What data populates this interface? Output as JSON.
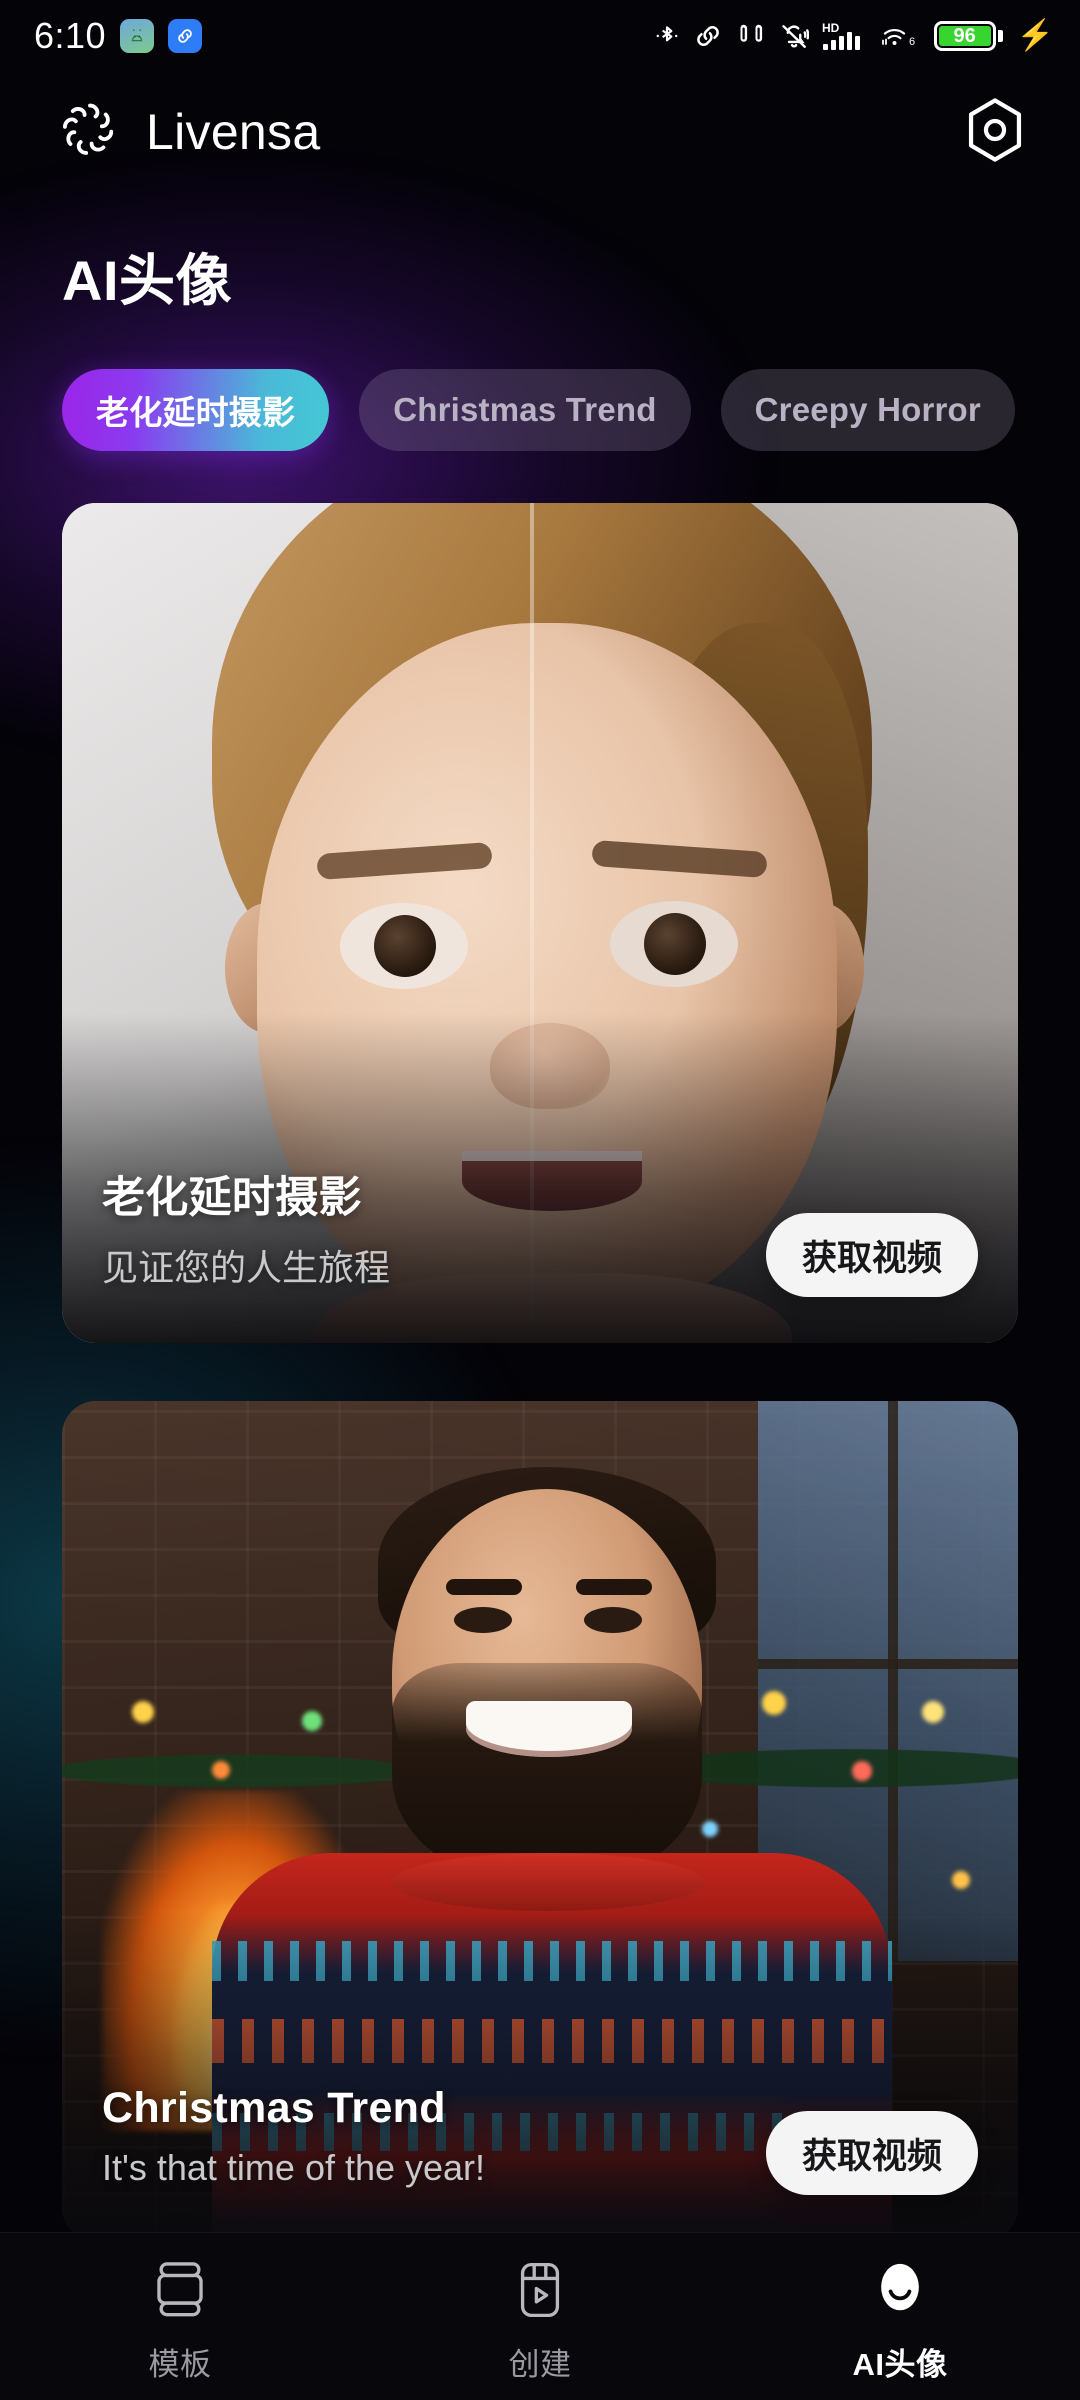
{
  "status_bar": {
    "time": "6:10",
    "left_icons": [
      "android-app-icon",
      "link-app-icon"
    ],
    "right_icons": [
      "bluetooth-icon",
      "link-icon",
      "earbuds-icon",
      "mute-bell-icon",
      "hd-signal-icon",
      "wifi-6-icon"
    ],
    "battery_percent": "96",
    "battery_color": "#38d430",
    "charging": "charging-bolt-icon"
  },
  "header": {
    "brand": "Livensa",
    "logo_icon": "livensa-knot-logo",
    "settings_icon": "hex-settings-icon"
  },
  "page": {
    "title": "AI头像"
  },
  "chips": [
    {
      "label": "老化延时摄影",
      "active": true
    },
    {
      "label": "Christmas Trend",
      "active": false
    },
    {
      "label": "Creepy Horror",
      "active": false
    }
  ],
  "cards": [
    {
      "title": "老化延时摄影",
      "subtitle": "见证您的人生旅程",
      "cta": "获取视频",
      "art": "toddler-aging-portrait"
    },
    {
      "title": "Christmas Trend",
      "subtitle": "It's that time of the year!",
      "cta": "获取视频",
      "art": "christmas-sweater-man"
    }
  ],
  "bottom_nav": [
    {
      "label": "模板",
      "icon": "template-icon",
      "active": false
    },
    {
      "label": "创建",
      "icon": "create-play-icon",
      "active": false
    },
    {
      "label": "AI头像",
      "icon": "ai-avatar-face-icon",
      "active": true
    }
  ],
  "colors": {
    "accent_start": "#9b25e8",
    "accent_end": "#44c8d4",
    "background": "#040308",
    "chip_idle": "#988ca8",
    "nav_background": "#07070c"
  }
}
